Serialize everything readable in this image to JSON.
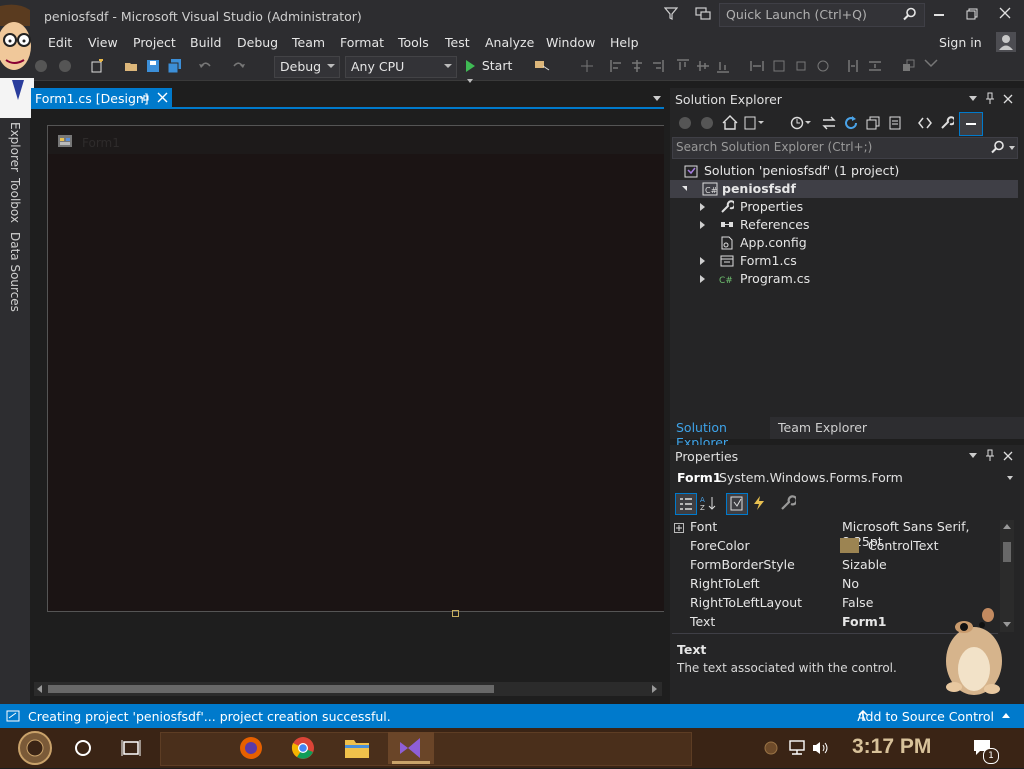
{
  "window": {
    "title": "peniosfsdf - Microsoft Visual Studio  (Administrator)",
    "quick_launch_placeholder": "Quick Launch (Ctrl+Q)",
    "sign_in": "Sign in"
  },
  "menu": [
    "Edit",
    "View",
    "Project",
    "Build",
    "Debug",
    "Team",
    "Format",
    "Tools",
    "Test",
    "Analyze",
    "Window",
    "Help"
  ],
  "toolbar": {
    "config": "Debug",
    "platform": "Any CPU",
    "start": "Start"
  },
  "left_tabs": [
    "Explorer",
    "Toolbox",
    "Data Sources"
  ],
  "document": {
    "tab_label": "Form1.cs [Design]",
    "form_title": "Form1"
  },
  "solution_explorer": {
    "title": "Solution Explorer",
    "search_placeholder": "Search Solution Explorer (Ctrl+;)",
    "solution": "Solution 'peniosfsdf' (1 project)",
    "project": "peniosfsdf",
    "items": [
      "Properties",
      "References",
      "App.config",
      "Form1.cs",
      "Program.cs"
    ],
    "tab_active": "Solution Explorer",
    "tab_other": "Team Explorer"
  },
  "properties": {
    "title": "Properties",
    "object_name": "Form1",
    "object_type": "System.Windows.Forms.Form",
    "rows": [
      {
        "name": "Font",
        "value": "Microsoft Sans Serif, 8.25pt"
      },
      {
        "name": "ForeColor",
        "value": "ControlText"
      },
      {
        "name": "FormBorderStyle",
        "value": "Sizable"
      },
      {
        "name": "RightToLeft",
        "value": "No"
      },
      {
        "name": "RightToLeftLayout",
        "value": "False"
      },
      {
        "name": "Text",
        "value": "Form1"
      }
    ],
    "forecolor_swatch": "#9c8452",
    "desc_title": "Text",
    "desc_text": "The text associated with the control."
  },
  "status": {
    "message": "Creating project 'peniosfsdf'... project creation successful.",
    "source_control": "Add to Source Control"
  },
  "taskbar": {
    "time": "3:17 PM",
    "notification_count": "1"
  },
  "colors": {
    "accent": "#007acc",
    "background": "#1e1e1e",
    "panel": "#252526"
  }
}
